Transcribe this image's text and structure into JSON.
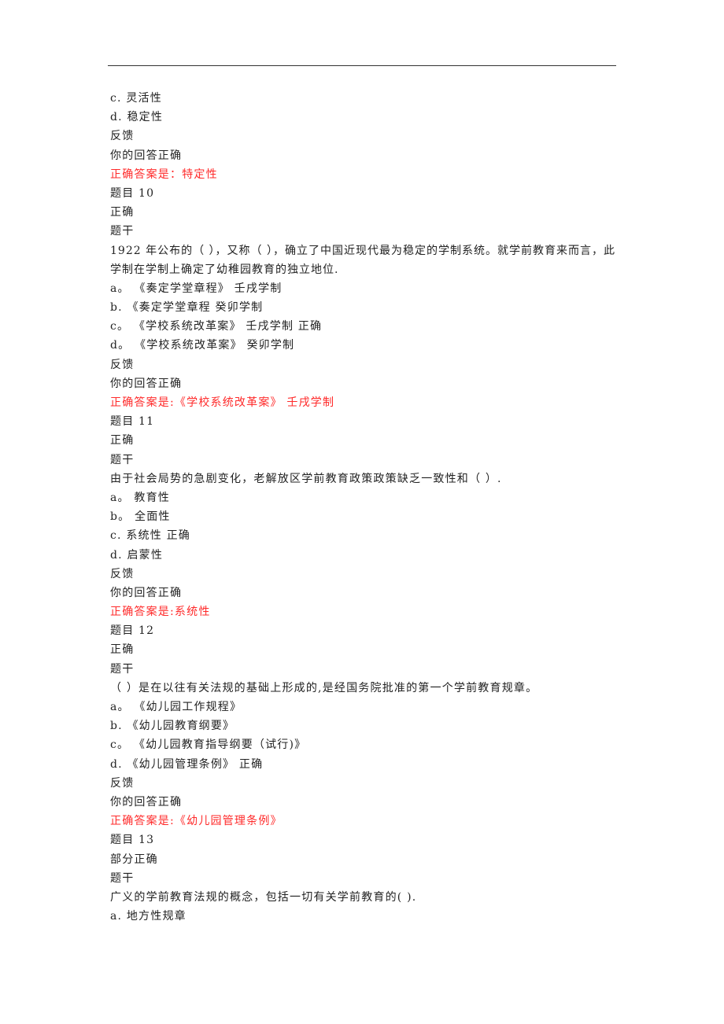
{
  "lines": [
    {
      "text": "c. 灵活性",
      "kind": "option"
    },
    {
      "text": "d. 稳定性",
      "kind": "option"
    },
    {
      "text": "反馈",
      "kind": "label"
    },
    {
      "text": "你的回答正确",
      "kind": "feedback"
    },
    {
      "text": "正确答案是：特定性",
      "kind": "answer"
    },
    {
      "text": "题目 10",
      "kind": "question-number"
    },
    {
      "text": "正确",
      "kind": "status"
    },
    {
      "text": "题干",
      "kind": "label"
    },
    {
      "text": "1922 年公布的（ ），又称（ ），确立了中国近现代最为稳定的学制系统。就学前教育来而言，此学制在学制上确定了幼稚园教育的独立地位.",
      "kind": "stem"
    },
    {
      "text": "a。 《奏定学堂章程》 壬戌学制",
      "kind": "option"
    },
    {
      "text": "b. 《奏定学堂章程 癸卯学制",
      "kind": "option"
    },
    {
      "text": "c。 《学校系统改革案》 壬戌学制 正确",
      "kind": "option"
    },
    {
      "text": "d。 《学校系统改革案》 癸卯学制",
      "kind": "option"
    },
    {
      "text": "反馈",
      "kind": "label"
    },
    {
      "text": "你的回答正确",
      "kind": "feedback"
    },
    {
      "text": "正确答案是:《学校系统改革案》 壬戌学制",
      "kind": "answer"
    },
    {
      "text": "题目 11",
      "kind": "question-number"
    },
    {
      "text": "正确",
      "kind": "status"
    },
    {
      "text": "题干",
      "kind": "label"
    },
    {
      "text": "由于社会局势的急剧变化，老解放区学前教育政策政策缺乏一致性和（ ）.",
      "kind": "stem"
    },
    {
      "text": "a。 教育性",
      "kind": "option"
    },
    {
      "text": "b。 全面性",
      "kind": "option"
    },
    {
      "text": "c. 系统性 正确",
      "kind": "option"
    },
    {
      "text": "d. 启蒙性",
      "kind": "option"
    },
    {
      "text": "反馈",
      "kind": "label"
    },
    {
      "text": "你的回答正确",
      "kind": "feedback"
    },
    {
      "text": "正确答案是:系统性",
      "kind": "answer"
    },
    {
      "text": "题目 12",
      "kind": "question-number"
    },
    {
      "text": "正确",
      "kind": "status"
    },
    {
      "text": "题干",
      "kind": "label"
    },
    {
      "text": "（ ）是在以往有关法规的基础上形成的,是经国务院批准的第一个学前教育规章。",
      "kind": "stem"
    },
    {
      "text": "a。 《幼儿园工作规程》",
      "kind": "option"
    },
    {
      "text": "b. 《幼儿园教育纲要》",
      "kind": "option"
    },
    {
      "text": "c。 《幼儿园教育指导纲要（试行)》",
      "kind": "option"
    },
    {
      "text": "d. 《幼儿园管理条例》 正确",
      "kind": "option"
    },
    {
      "text": "反馈",
      "kind": "label"
    },
    {
      "text": "你的回答正确",
      "kind": "feedback"
    },
    {
      "text": "正确答案是:《幼儿园管理条例》",
      "kind": "answer"
    },
    {
      "text": "题目 13",
      "kind": "question-number"
    },
    {
      "text": "部分正确",
      "kind": "status"
    },
    {
      "text": "题干",
      "kind": "label"
    },
    {
      "text": "广义的学前教育法规的概念，包括一切有关学前教育的( ).",
      "kind": "stem"
    },
    {
      "text": "a. 地方性规章",
      "kind": "option"
    }
  ],
  "colors": {
    "text": "#222222",
    "answer": "#ff2a2a",
    "rule": "#333333"
  }
}
